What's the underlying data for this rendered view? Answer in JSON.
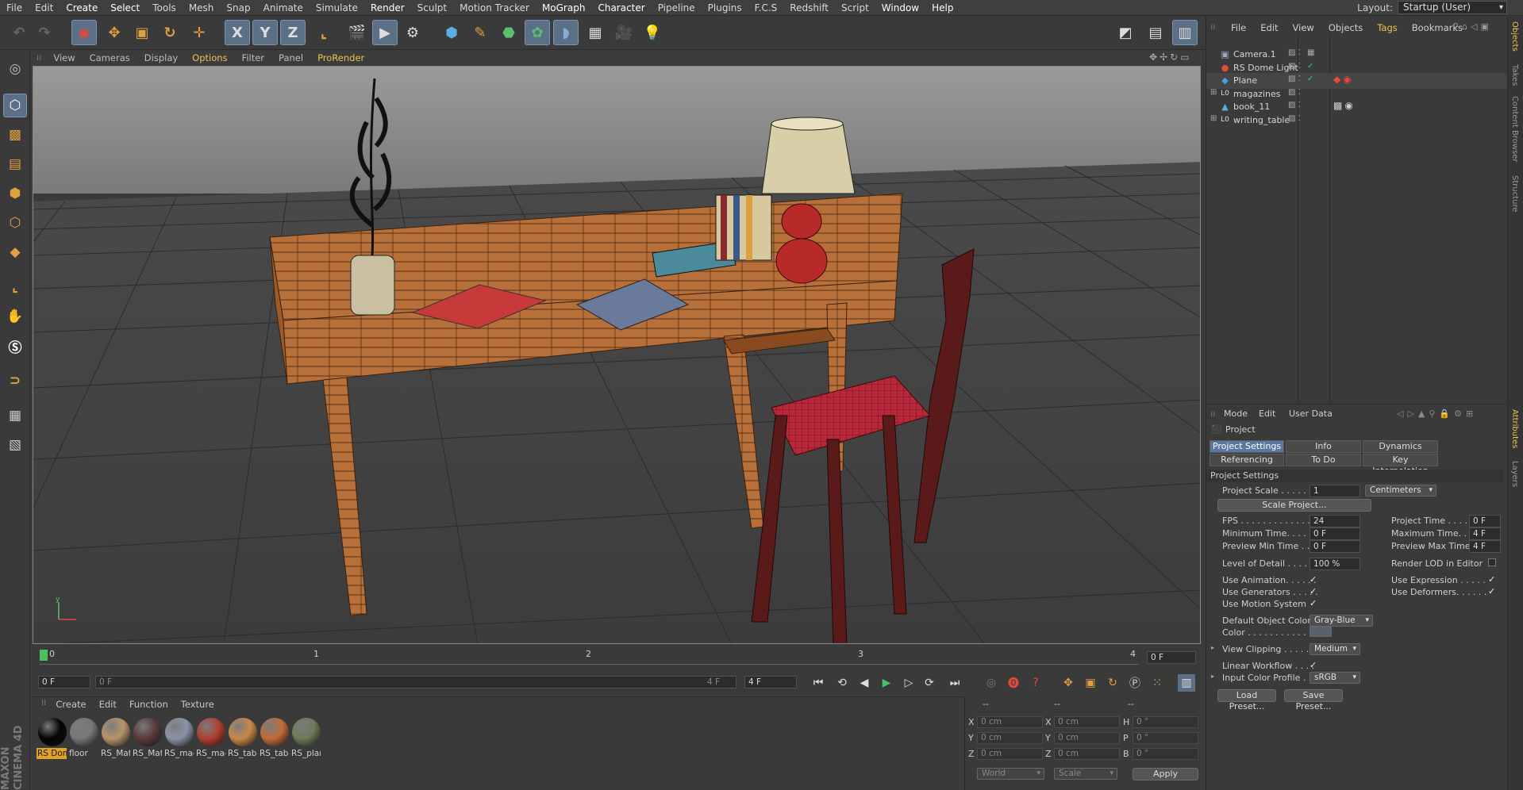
{
  "menubar": {
    "items": [
      "File",
      "Edit",
      "Create",
      "Select",
      "Tools",
      "Mesh",
      "Snap",
      "Animate",
      "Simulate",
      "Render",
      "Sculpt",
      "Motion Tracker",
      "MoGraph",
      "Character",
      "Pipeline",
      "Plugins",
      "F.C.S",
      "Redshift",
      "Script",
      "Window",
      "Help"
    ],
    "layout_label": "Layout:",
    "layout_value": "Startup (User)"
  },
  "toolbar": {
    "x_label": "X",
    "y_label": "Y",
    "z_label": "Z"
  },
  "viewport_menu": {
    "items": [
      "View",
      "Cameras",
      "Display",
      "Options",
      "Filter",
      "Panel",
      "ProRender"
    ]
  },
  "timeline": {
    "ticks": [
      "0",
      "1",
      "2",
      "3",
      "4"
    ],
    "current_frame": "0 F",
    "start_field": "0 F",
    "range_start": "0 F",
    "range_end": "4 F",
    "end_field": "4 F"
  },
  "material_menu": {
    "items": [
      "Create",
      "Edit",
      "Function",
      "Texture"
    ]
  },
  "materials": [
    {
      "label": "RS Dom",
      "color": "#050505"
    },
    {
      "label": "floor",
      "color": "#777777"
    },
    {
      "label": "RS_Mate",
      "color": "#b89468"
    },
    {
      "label": "RS_Mat",
      "color": "#5a3a3a"
    },
    {
      "label": "RS_mag",
      "color": "#8a94a8"
    },
    {
      "label": "RS_mag",
      "color": "#b04030"
    },
    {
      "label": "RS_table",
      "color": "#c88848"
    },
    {
      "label": "RS_table",
      "color": "#c06a3a"
    },
    {
      "label": "RS_plan",
      "color": "#6f7a5a"
    }
  ],
  "coords": {
    "header1": "--",
    "header2": "--",
    "header3": "--",
    "x_label": "X",
    "y_label": "Y",
    "z_label": "Z",
    "h_label": "H",
    "p_label": "P",
    "b_label": "B",
    "px": "0 cm",
    "py": "0 cm",
    "pz": "0 cm",
    "sx": "0 cm",
    "sy": "0 cm",
    "sz": "0 cm",
    "rh": "0 °",
    "rp": "0 °",
    "rb": "0 °",
    "mode1": "World",
    "mode2": "Scale",
    "apply": "Apply"
  },
  "objects": {
    "menu": [
      "File",
      "Edit",
      "View",
      "Objects",
      "Tags",
      "Bookmarks"
    ],
    "items": [
      {
        "name": "Camera.1",
        "icon": "camera-icon",
        "glyph": "▣",
        "color": "#9ab"
      },
      {
        "name": "RS Dome Light",
        "icon": "dome-light-icon",
        "glyph": "●",
        "color": "#e24a3a"
      },
      {
        "name": "Plane",
        "icon": "plane-icon",
        "glyph": "◆",
        "color": "#4aa0e0"
      },
      {
        "name": "magazines",
        "icon": "null-icon",
        "glyph": "L0",
        "color": "#ddd"
      },
      {
        "name": "book_11",
        "icon": "polygon-icon",
        "glyph": "▲",
        "color": "#5ab0e0"
      },
      {
        "name": "writing_table",
        "icon": "null-icon",
        "glyph": "L0",
        "color": "#ddd"
      }
    ]
  },
  "attributes": {
    "menu": [
      "Mode",
      "Edit",
      "User Data"
    ],
    "title": "Project",
    "tabs": [
      "Project Settings",
      "Info",
      "Dynamics",
      "Referencing",
      "To Do",
      "Key Interpolation"
    ],
    "section": "Project Settings",
    "project_scale_label": "Project Scale . . . . . .",
    "project_scale_value": "1",
    "project_scale_unit": "Centimeters",
    "scale_project_btn": "Scale Project...",
    "fps_label": "FPS . . . . . . . . . . . . .",
    "fps_value": "24",
    "project_time_label": "Project Time . . . . . .",
    "project_time_value": "0 F",
    "min_time_label": "Minimum Time. . . . . .",
    "min_time_value": "0 F",
    "max_time_label": "Maximum Time. . . . . .",
    "max_time_value": "4 F",
    "prev_min_label": "Preview Min Time . . .",
    "prev_min_value": "0 F",
    "prev_max_label": "Preview Max Time . . .",
    "prev_max_value": "4 F",
    "lod_label": "Level of Detail . . . . .",
    "lod_value": "100 %",
    "render_lod_label": "Render LOD in Editor",
    "use_anim_label": "Use Animation. . . . . .",
    "use_expr_label": "Use Expression . . . . .",
    "use_gen_label": "Use Generators . . . . .",
    "use_def_label": "Use Deformers. . . . . .",
    "use_motion_label": "Use Motion System",
    "def_obj_color_label": "Default Object Color",
    "def_obj_color_value": "Gray-Blue",
    "color_label": "Color . . . . . . . . . . .",
    "view_clip_label": "View Clipping . . . . . .",
    "view_clip_value": "Medium",
    "linear_wf_label": "Linear Workflow . . . .",
    "input_profile_label": "Input Color Profile . .",
    "input_profile_value": "sRGB",
    "load_preset": "Load Preset...",
    "save_preset": "Save Preset...",
    "check": "✓"
  },
  "sidetabs": [
    "Objects",
    "Takes",
    "Content Browser",
    "Structure",
    "Attributes",
    "Layers"
  ]
}
